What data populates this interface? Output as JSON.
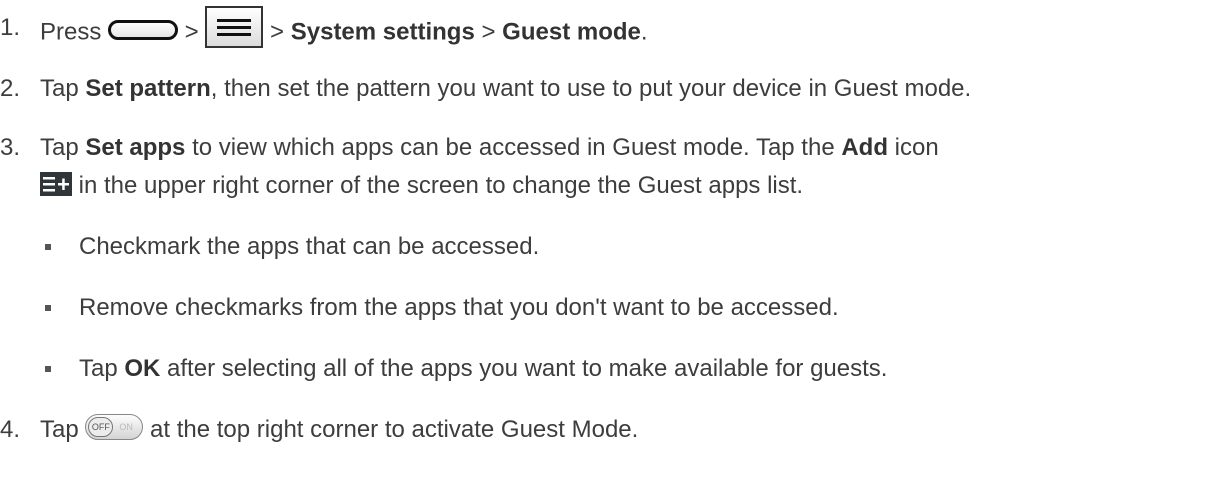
{
  "steps": [
    {
      "num": "1.",
      "t1": "Press ",
      "t2": " > ",
      "t3": " > ",
      "b1": "System settings",
      "t4": " > ",
      "b2": "Guest mode",
      "t5": "."
    },
    {
      "num": "2.",
      "t1": "Tap ",
      "b1": "Set pattern",
      "t2": ", then set the pattern you want to use to put your device in Guest mode."
    },
    {
      "num": "3.",
      "t1": "Tap ",
      "b1": "Set apps",
      "t2": " to view which apps can be accessed in Guest mode. Tap the ",
      "b2": "Add",
      "t3": " icon",
      "line2": " in the upper right corner of the screen to change the Guest apps list."
    },
    {
      "num": "4.",
      "t1": "Tap ",
      "t2": " at the top right corner to activate Guest Mode."
    }
  ],
  "bullets": [
    {
      "text": "Checkmark the apps that can be accessed."
    },
    {
      "text": "Remove checkmarks from the apps that you don't want to be accessed."
    },
    {
      "t1": "Tap ",
      "b1": "OK",
      "t2": " after selecting all of the apps you want to make available for guests."
    }
  ],
  "icons": {
    "home": "home-key-icon",
    "menu": "menu-icon",
    "add": "add-icon",
    "toggle": "off-on-toggle-icon",
    "toggle_off_label": "OFF",
    "toggle_on_label": "ON",
    "add_color": "#2f3538"
  }
}
